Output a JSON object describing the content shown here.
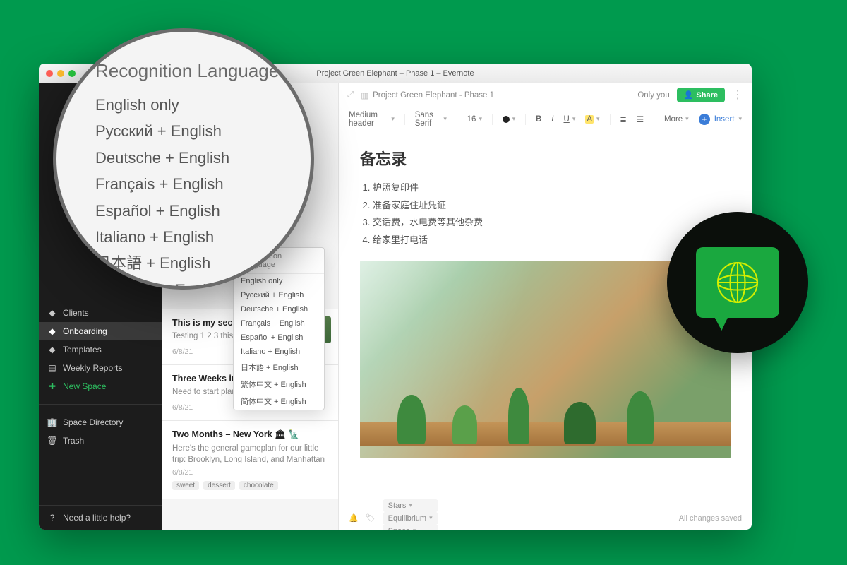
{
  "window_title": "Project Green Elephant – Phase 1 – Evernote",
  "sidebar": {
    "items": [
      {
        "label": "Clients",
        "icon": "cube"
      },
      {
        "label": "Onboarding",
        "icon": "cube",
        "active": true
      },
      {
        "label": "Templates",
        "icon": "cube"
      },
      {
        "label": "Weekly Reports",
        "icon": "doc"
      },
      {
        "label": "New Space",
        "icon": "plus",
        "green": true
      }
    ],
    "secondary": [
      {
        "label": "Space Directory",
        "icon": "building"
      },
      {
        "label": "Trash",
        "icon": "trash"
      }
    ],
    "footer": "Need a little help?"
  },
  "lang_dropdown": {
    "header": "Recognition Language",
    "options": [
      "English only",
      "Русский + English",
      "Deutsche + English",
      "Français + English",
      "Español + English",
      "Italiano + English",
      "日本語 + English",
      "繁体中文 + English",
      "简体中文 + English"
    ]
  },
  "notes": [
    {
      "title": "This is my secor",
      "snippet": "Testing 1 2 3 this\nTesting 1 2 3 this",
      "date": "6/8/21",
      "thumb": true
    },
    {
      "title": "Three Weeks in Shanghai",
      "snippet": "Need to start planning for this trip",
      "date": "6/8/21"
    },
    {
      "title": "Two Months – New York  🏛 🗽",
      "snippet": "Here's the general gameplan for our little trip: Brooklyn, Long Island, and Manhattan If we have...",
      "date": "6/8/21",
      "tags": [
        "sweet",
        "dessert",
        "chocolate"
      ]
    }
  ],
  "editor": {
    "breadcrumb": "Project Green Elephant - Phase 1",
    "only_you": "Only you",
    "share": "Share",
    "toolbar": {
      "style": "Medium header",
      "font": "Sans Serif",
      "size": "16",
      "more": "More",
      "insert": "Insert"
    },
    "doc": {
      "title": "备忘录",
      "items": [
        "护照复印件",
        "准备家庭住址凭证",
        "交话费，水电费等其他杂费",
        "给家里打电话"
      ]
    },
    "footer": {
      "pills": [
        "Stars",
        "Equilibrium",
        "Space"
      ],
      "status": "All changes saved"
    }
  },
  "magnifier": {
    "title": "Recognition Language",
    "options": [
      "English only",
      "Русский + English",
      "Deutsche + English",
      "Français + English",
      "Español + English",
      "Italiano + English",
      "日本語 + English",
      "繁体中文 + English",
      "简体中文 + English"
    ]
  }
}
